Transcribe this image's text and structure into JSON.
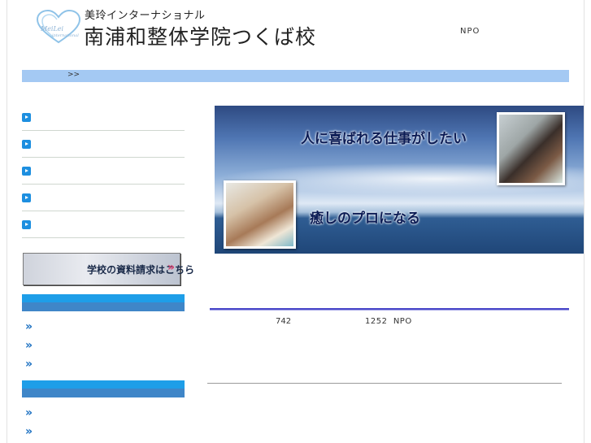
{
  "header": {
    "logo_name": "heart-logo",
    "subtitle": "美玲インターナショナル",
    "title": "南浦和整体学院つくば校",
    "npo": "NPO"
  },
  "breadcrumb": {
    "arrow": ">>"
  },
  "nav": {
    "items": [
      "",
      "",
      "",
      "",
      ""
    ]
  },
  "request_button": {
    "label": "学校の資料請求はこちら",
    "arrow": "»"
  },
  "sections": [
    {
      "links": [
        "»",
        "»",
        "»"
      ]
    },
    {
      "links": [
        "»",
        "»"
      ]
    }
  ],
  "hero": {
    "line1": "人に喜ばれる仕事がしたい",
    "line2": "癒しのプロになる"
  },
  "info": {
    "num1": "742",
    "num2": "1252",
    "npo": "NPO"
  },
  "colors": {
    "breadcrumb_bar": "#a4c9f3",
    "accent_blue": "#1e9ee8",
    "rule": "#4a48c9"
  }
}
